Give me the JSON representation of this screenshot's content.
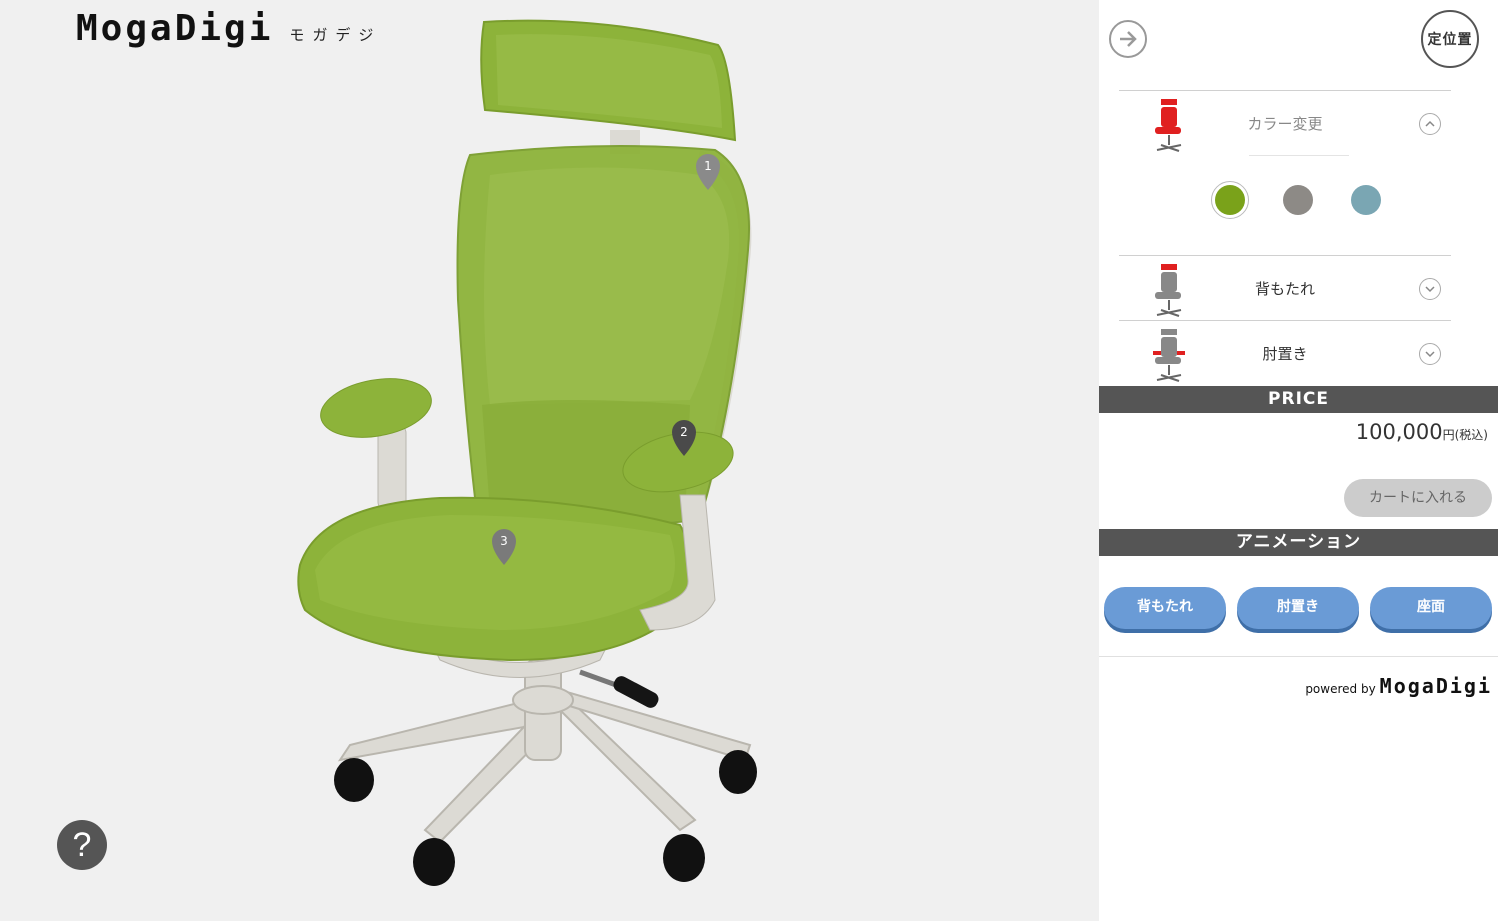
{
  "brand": {
    "logo": "MogaDigi",
    "logo_sub": "モガデジ"
  },
  "hotspots": [
    "1",
    "2",
    "3"
  ],
  "viewer": {
    "help_label": "?"
  },
  "panel": {
    "reset_label": "定位置",
    "next_icon": "arrow-right-circle-icon",
    "color_section": {
      "label": "カラー変更",
      "expanded": true,
      "swatches": [
        {
          "name": "green",
          "color": "#7aa21a",
          "selected": true
        },
        {
          "name": "gray",
          "color": "#8d8a86",
          "selected": false
        },
        {
          "name": "blue",
          "color": "#7aa6b3",
          "selected": false
        }
      ]
    },
    "sections": [
      {
        "label": "背もたれ",
        "expanded": false
      },
      {
        "label": "肘置き",
        "expanded": false
      }
    ],
    "price": {
      "header": "PRICE",
      "value": "100,000",
      "unit": "円(税込)"
    },
    "cart_label": "カートに入れる",
    "animation": {
      "header": "アニメーション",
      "buttons": [
        "背もたれ",
        "肘置き",
        "座面"
      ]
    },
    "powered": {
      "prefix": "powered by",
      "brand": "MogaDigi"
    }
  },
  "colors": {
    "chair_green": "#8db33a",
    "accent_blue": "#6a9bd6",
    "bar_gray": "#555555",
    "highlight_red": "#e02020"
  }
}
